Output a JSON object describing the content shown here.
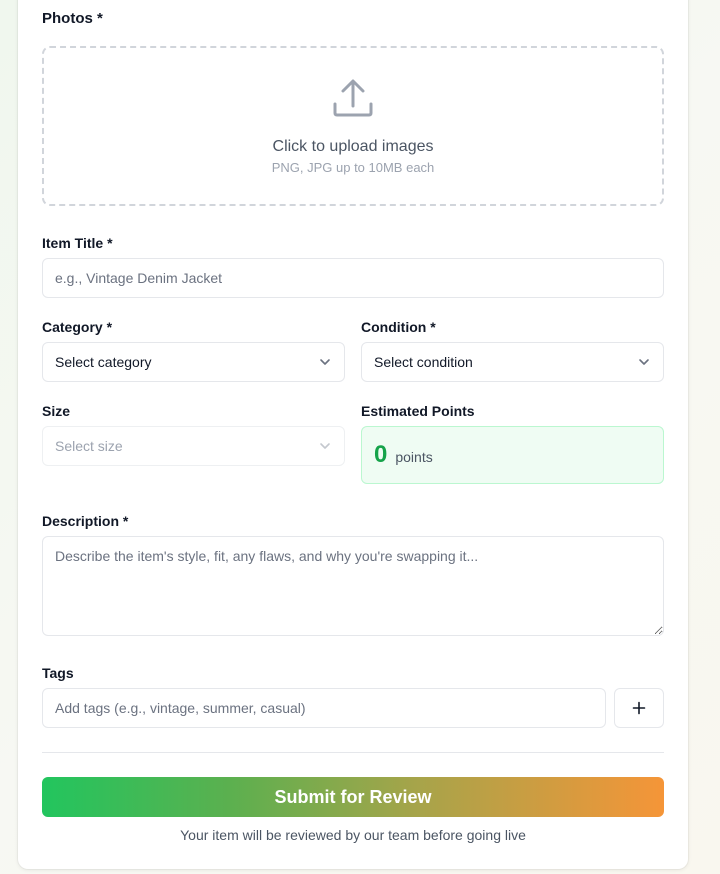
{
  "photos": {
    "label": "Photos *",
    "upload_title": "Click to upload images",
    "upload_hint": "PNG, JPG up to 10MB each",
    "icon": "upload-icon"
  },
  "title_field": {
    "label": "Item Title *",
    "placeholder": "e.g., Vintage Denim Jacket"
  },
  "category": {
    "label": "Category *",
    "value": "Select category"
  },
  "condition": {
    "label": "Condition *",
    "value": "Select condition"
  },
  "size": {
    "label": "Size",
    "value": "Select size"
  },
  "estimated_points": {
    "label": "Estimated Points",
    "value": "0",
    "unit": "points"
  },
  "description": {
    "label": "Description *",
    "placeholder": "Describe the item's style, fit, any flaws, and why you're swapping it..."
  },
  "tags": {
    "label": "Tags",
    "placeholder": "Add tags (e.g., vintage, summer, casual)",
    "add_icon": "plus-icon"
  },
  "submit": {
    "label": "Submit for Review",
    "note": "Your item will be reviewed by our team before going live"
  },
  "colors": {
    "accent_green": "#16a34a",
    "gradient_start": "#22c55e",
    "gradient_end": "#f59538"
  }
}
